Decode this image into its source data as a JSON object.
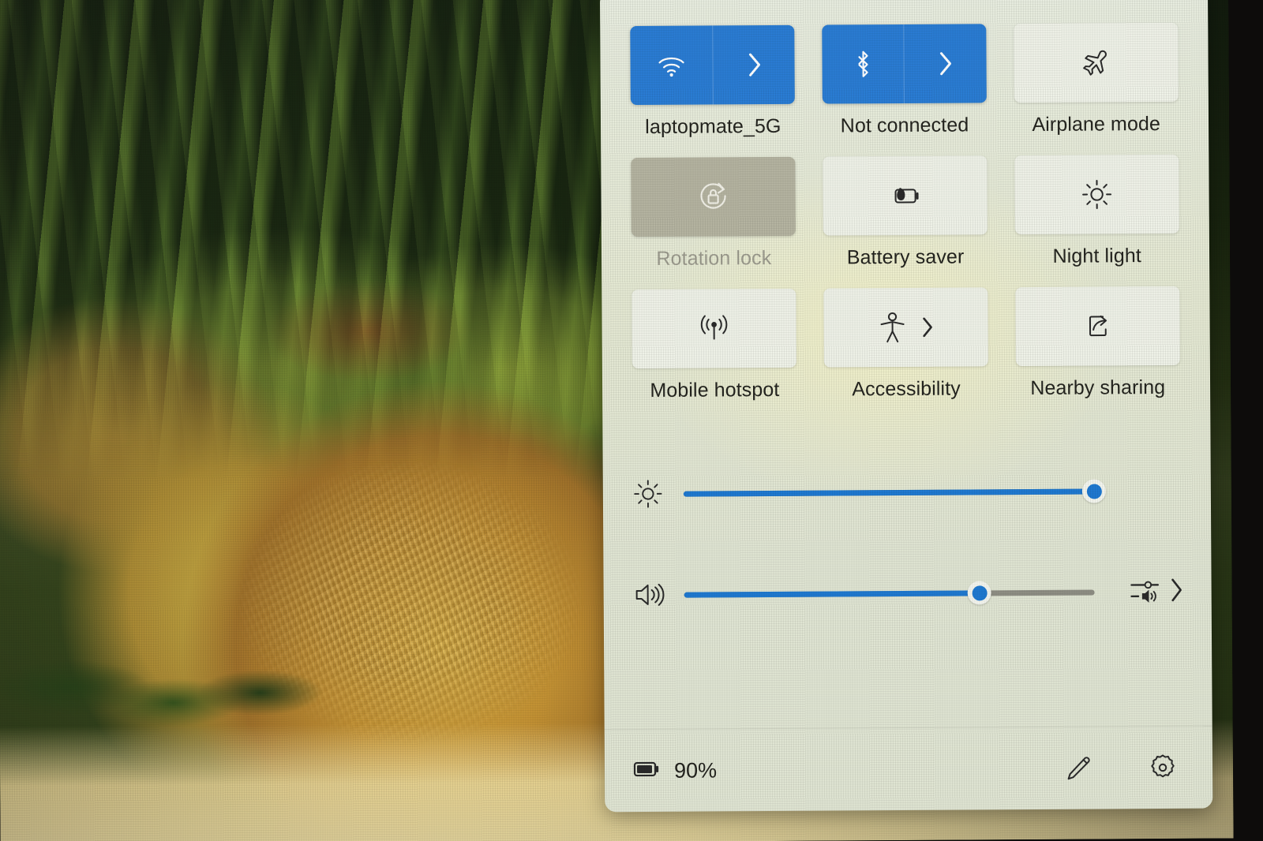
{
  "panel": {
    "name": "Windows Quick Settings",
    "accent_color": "#2a7cd3",
    "panel_bg": "#dfe4d2",
    "tile_bg": "#eef1e7",
    "disabled_bg": "#b4b3a0"
  },
  "tiles": [
    {
      "id": "wifi",
      "label": "laptopmate_5G",
      "icon": "wifi-icon",
      "state": "on",
      "split": true,
      "chevron": true,
      "disabled": false
    },
    {
      "id": "bluetooth",
      "label": "Not connected",
      "icon": "bluetooth-icon",
      "state": "on",
      "split": true,
      "chevron": true,
      "disabled": false
    },
    {
      "id": "airplane-mode",
      "label": "Airplane mode",
      "icon": "airplane-icon",
      "state": "off",
      "split": false,
      "chevron": false,
      "disabled": false
    },
    {
      "id": "rotation-lock",
      "label": "Rotation lock",
      "icon": "rotation-lock-icon",
      "state": "off",
      "split": false,
      "chevron": false,
      "disabled": true
    },
    {
      "id": "battery-saver",
      "label": "Battery saver",
      "icon": "battery-leaf-icon",
      "state": "off",
      "split": false,
      "chevron": false,
      "disabled": false
    },
    {
      "id": "night-light",
      "label": "Night light",
      "icon": "brightness-icon",
      "state": "off",
      "split": false,
      "chevron": false,
      "disabled": false
    },
    {
      "id": "mobile-hotspot",
      "label": "Mobile hotspot",
      "icon": "broadcast-icon",
      "state": "off",
      "split": false,
      "chevron": false,
      "disabled": false
    },
    {
      "id": "accessibility",
      "label": "Accessibility",
      "icon": "accessibility-person-icon",
      "state": "off",
      "split": false,
      "chevron": true,
      "disabled": false
    },
    {
      "id": "nearby-sharing",
      "label": "Nearby sharing",
      "icon": "share-icon",
      "state": "off",
      "split": false,
      "chevron": false,
      "disabled": false
    }
  ],
  "sliders": {
    "brightness": {
      "name": "Brightness",
      "icon": "brightness-icon",
      "value": 100,
      "min": 0,
      "max": 100
    },
    "volume": {
      "name": "Volume",
      "icon": "speaker-icon",
      "value": 72,
      "min": 0,
      "max": 100,
      "trailing_icon": "audio-output-picker-icon",
      "trailing_chevron": true
    }
  },
  "footer": {
    "battery_icon": "battery-icon",
    "battery_percent": "90%",
    "edit_icon": "pencil-edit-icon",
    "settings_icon": "gear-settings-icon"
  }
}
